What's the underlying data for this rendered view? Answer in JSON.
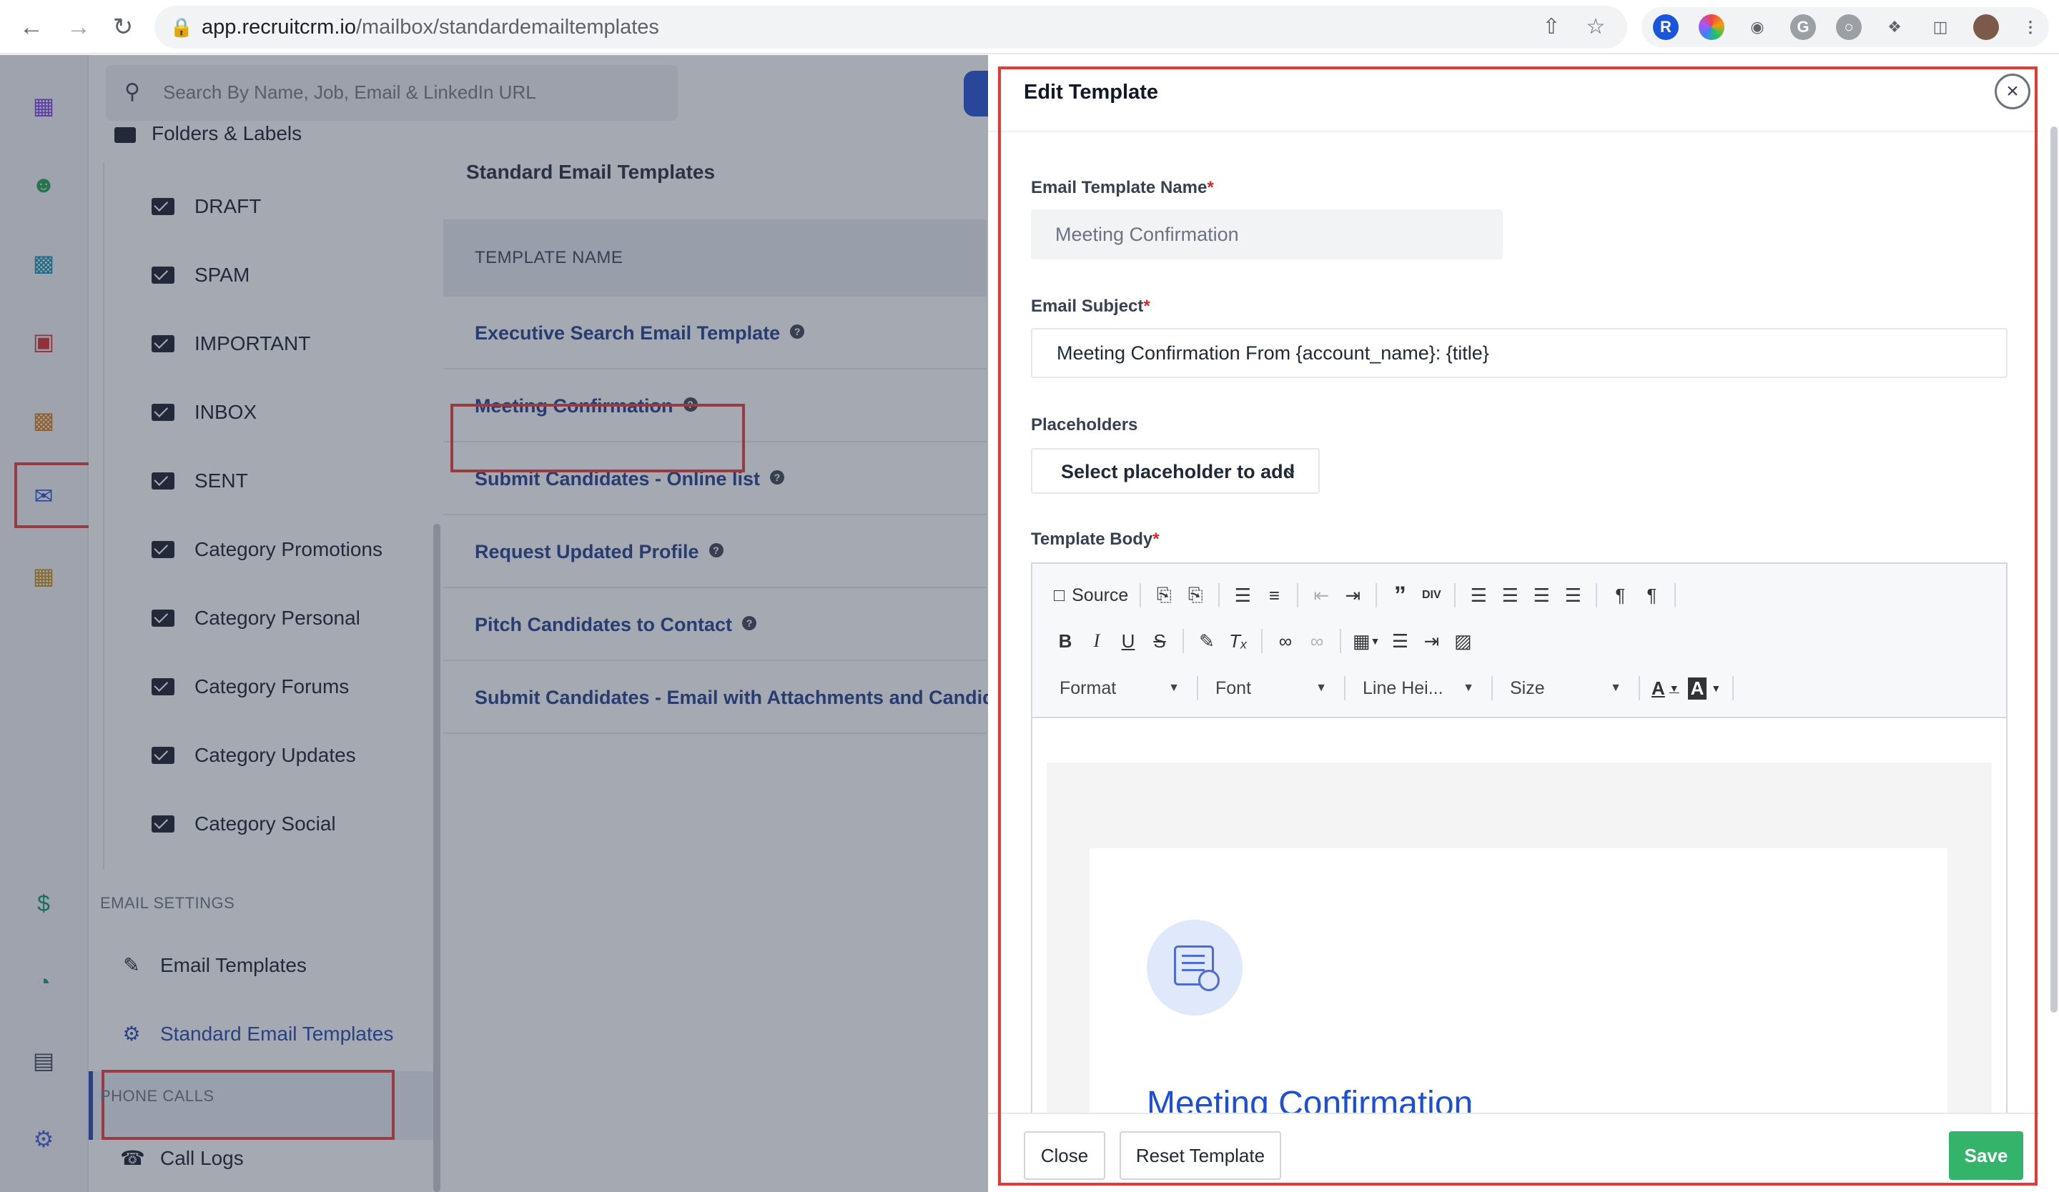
{
  "browser": {
    "url_domain": "app.recruitcrm.io",
    "url_path": "/mailbox/standardemailtemplates",
    "back_icon": "arrow-left",
    "forward_icon": "arrow-right",
    "reload_icon": "reload"
  },
  "search": {
    "placeholder": "Search By Name, Job, Email & LinkedIn URL"
  },
  "sidebar": {
    "folders_heading": "Folders & Labels",
    "folders": [
      "DRAFT",
      "SPAM",
      "IMPORTANT",
      "INBOX",
      "SENT",
      "Category Promotions",
      "Category Personal",
      "Category Forums",
      "Category Updates",
      "Category Social"
    ],
    "email_settings_label": "EMAIL SETTINGS",
    "email_templates": "Email Templates",
    "standard_email_templates": "Standard Email Templates",
    "phone_calls_label": "PHONE CALLS",
    "call_logs": "Call Logs"
  },
  "content": {
    "title": "Standard Email Templates",
    "column_header": "TEMPLATE NAME",
    "rows": [
      "Executive Search Email Template",
      "Meeting Confirmation",
      "Submit Candidates - Online list",
      "Request Updated Profile",
      "Pitch Candidates to Contact",
      "Submit Candidates - Email with Attachments and Candidate ..."
    ]
  },
  "drawer": {
    "title": "Edit Template",
    "close_glyph": "×",
    "name_label": "Email Template Name",
    "name_value": "Meeting Confirmation",
    "subject_label": "Email Subject",
    "subject_value": "Meeting Confirmation From {account_name}: {title}",
    "placeholders_label": "Placeholders",
    "placeholders_select": "Select placeholder to add",
    "body_label": "Template Body",
    "required_mark": "*",
    "toolbar": {
      "source": "Source",
      "format": "Format",
      "font": "Font",
      "line_height": "Line Hei...",
      "size": "Size"
    },
    "body_heading": "Meeting Confirmation",
    "close_button": "Close",
    "reset_button": "Reset Template",
    "save_button": "Save"
  },
  "colors": {
    "accent": "#1e40af",
    "highlight_red": "#e53935",
    "save_green": "#34b36b",
    "link_blue": "#1d4ed8"
  }
}
